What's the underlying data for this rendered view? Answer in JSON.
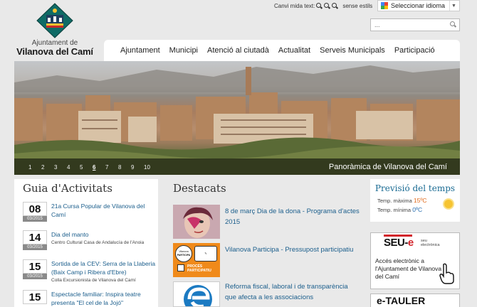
{
  "logo": {
    "line1": "Ajuntament de",
    "line2": "Vilanova del Camí"
  },
  "textsize": {
    "label": "Canvi mida text:",
    "reset": "sense estils"
  },
  "language": {
    "label": "Seleccionar idioma",
    "caret": "▼"
  },
  "search": {
    "placeholder": "..."
  },
  "nav": {
    "items": [
      "Ajuntament",
      "Municipi",
      "Atenció al ciutadà",
      "Actualitat",
      "Serveis Municipals",
      "Participació"
    ]
  },
  "banner": {
    "pages": [
      "1",
      "2",
      "3",
      "4",
      "5",
      "6",
      "7",
      "8",
      "9",
      "10"
    ],
    "active_page": "6",
    "caption": "Panoràmica de Vilanova del Camí"
  },
  "guia": {
    "title": "Guia d'Activitats",
    "events": [
      {
        "day": "08",
        "month": "03/2015",
        "title": "21a Cursa Popular de Vilanova del Camí",
        "subtitle": ""
      },
      {
        "day": "14",
        "month": "03/2015",
        "title": "Dia del manto",
        "subtitle": "Centro Cultural Casa de Andalucía de l'Anoia"
      },
      {
        "day": "15",
        "month": "03/2015",
        "title": "Sortida de la CEV: Serra de la Llaberia (Baix Camp i Ribera d'Ebre)",
        "subtitle": "Colla Excursionista de Vilanova del Camí"
      },
      {
        "day": "15",
        "month": "",
        "title": "Espectacle familiar: Inspira teatre presenta \"El cel de la Jojó\"",
        "subtitle": ""
      }
    ]
  },
  "destacats": {
    "title": "Destacats",
    "items": [
      {
        "text": "8 de març Dia de la dona - Programa d'actes 2015"
      },
      {
        "text": "Vilanova Participa - Pressupost participatiu"
      },
      {
        "text": "Reforma fiscal, laboral i de transparència que afecta a les associacions"
      }
    ],
    "thumb2": {
      "line1": "Vilanova",
      "line2": "PARTICIPA",
      "line3": "PROCÉS",
      "line4": "PARTICIPATIU"
    }
  },
  "weather": {
    "title": "Previsió del temps",
    "max_label": "Temp. màxima",
    "max_value": "15ºC",
    "min_label": "Temp. mínima",
    "min_value": "0ºC"
  },
  "seu": {
    "brand_main": "SEU-",
    "brand_e": "e",
    "brand_sub1": "seu",
    "brand_sub2": "electrònica",
    "text": "Accés electrònic a l'Ajuntament de Vilanova del Camí"
  },
  "etauler": {
    "label": "e-TAULER"
  },
  "colors": {
    "link": "#1b5e8c",
    "weather_title": "#1a6b93",
    "temp_max": "#e06a1b",
    "temp_min": "#2a6fb0",
    "seu_red": "#d2232a"
  }
}
